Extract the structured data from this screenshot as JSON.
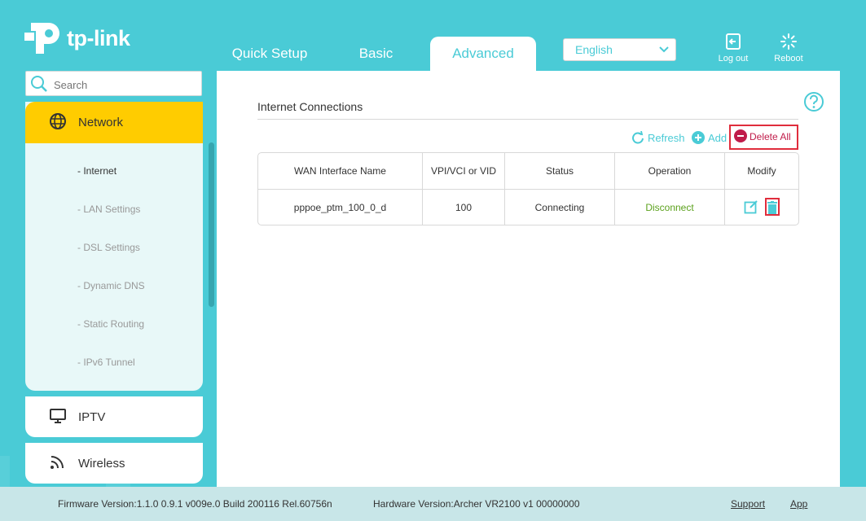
{
  "brand": {
    "name": "tp-link"
  },
  "tabs": [
    {
      "label": "Quick Setup"
    },
    {
      "label": "Basic"
    },
    {
      "label": "Advanced"
    }
  ],
  "language": {
    "selected": "English"
  },
  "top_actions": {
    "logout": "Log out",
    "reboot": "Reboot"
  },
  "search": {
    "placeholder": "Search"
  },
  "sidebar": {
    "active_category": "Network",
    "sub_items": [
      {
        "label": "- Internet"
      },
      {
        "label": "- LAN Settings"
      },
      {
        "label": "- DSL Settings"
      },
      {
        "label": "- Dynamic DNS"
      },
      {
        "label": "- Static Routing"
      },
      {
        "label": "- IPv6 Tunnel"
      }
    ],
    "categories": [
      {
        "label": "IPTV"
      },
      {
        "label": "Wireless"
      }
    ]
  },
  "main": {
    "section_title": "Internet Connections",
    "actions": {
      "refresh": "Refresh",
      "add": "Add",
      "delete_all": "Delete All"
    },
    "table": {
      "headers": [
        "WAN Interface Name",
        "VPI/VCI or VID",
        "Status",
        "Operation",
        "Modify"
      ],
      "rows": [
        {
          "name": "pppoe_ptm_100_0_d",
          "vid": "100",
          "status": "Connecting",
          "operation": "Disconnect"
        }
      ]
    }
  },
  "footer": {
    "firmware": "Firmware Version:1.1.0 0.9.1 v009e.0 Build 200116 Rel.60756n",
    "hardware": "Hardware Version:Archer VR2100 v1 00000000",
    "support": "Support",
    "app": "App"
  },
  "colors": {
    "accent": "#4acbd6",
    "active": "#ffcc00",
    "danger": "#e02d3c",
    "ok": "#5ba11c"
  }
}
